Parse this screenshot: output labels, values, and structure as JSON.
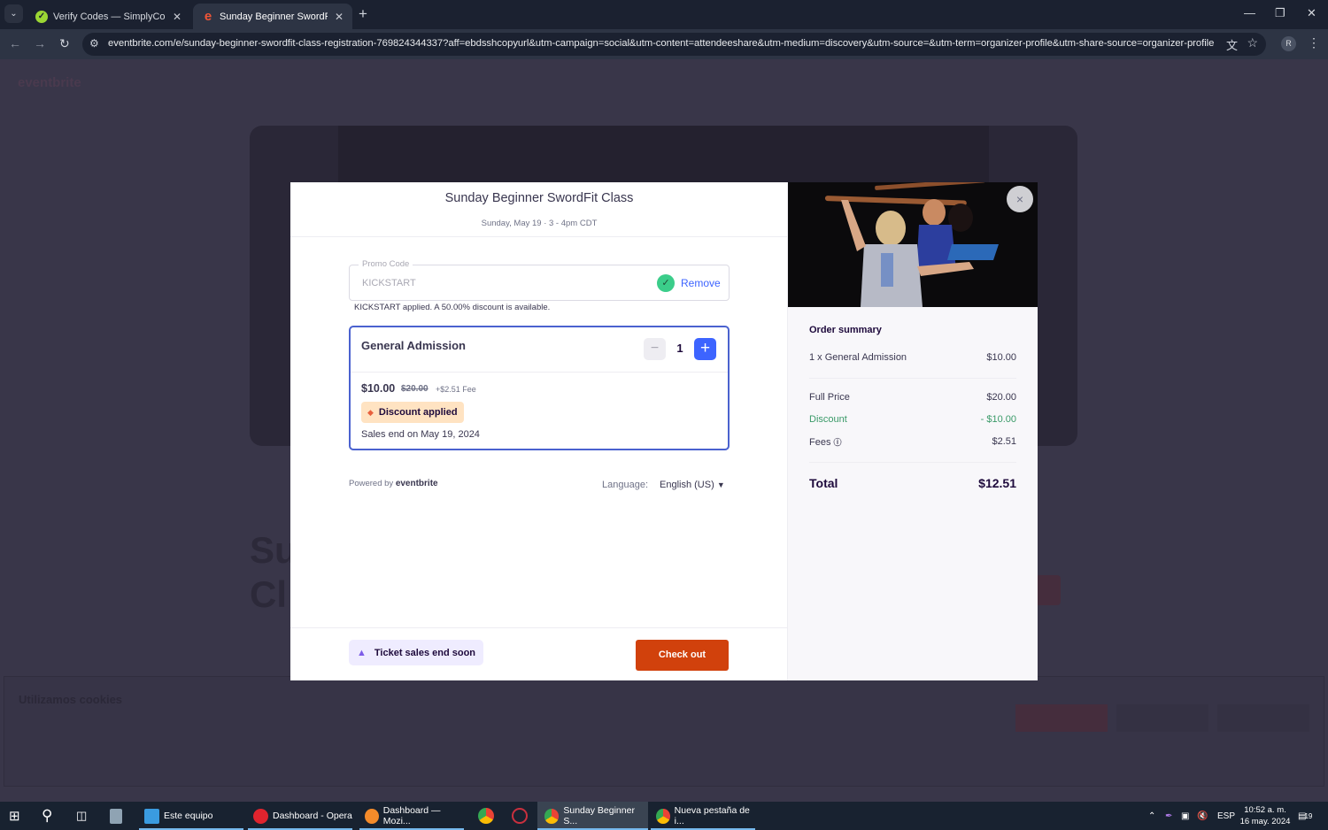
{
  "browser": {
    "tabs": [
      {
        "title": "Verify Codes — SimplyCodes",
        "icon": "simplycodes-icon",
        "active": false
      },
      {
        "title": "Sunday Beginner SwordFit Class",
        "icon": "eventbrite-icon",
        "active": true
      }
    ],
    "new_tab_label": "+",
    "url": "eventbrite.com/e/sunday-beginner-swordfit-class-registration-769824344337?aff=ebdsshcopyurl&utm-campaign=social&utm-content=attendeeshare&utm-medium=discovery&utm-source=&utm-term=organizer-profile&utm-share-source=organizer-profile",
    "profile_initial": "R"
  },
  "background_page": {
    "logo": "eventbrite",
    "cookie_title": "Utilizamos cookies",
    "title_fragment": "Su Cl"
  },
  "modal": {
    "event_title": "Sunday Beginner SwordFit Class",
    "event_date": "Sunday, May 19 · 3 - 4pm CDT",
    "promo": {
      "label": "Promo Code",
      "value": "KICKSTART",
      "remove_label": "Remove",
      "message": "KICKSTART applied. A 50.00% discount is available."
    },
    "ticket": {
      "name": "General Admission",
      "quantity": "1",
      "minus_label": "−",
      "plus_label": "+",
      "price": "$10.00",
      "original_price": "$20.00",
      "fee": "+$2.51 Fee",
      "discount_badge": "Discount applied",
      "sales_end": "Sales end on May 19, 2024"
    },
    "powered_by": "Powered by",
    "powered_brand": "eventbrite",
    "language_label": "Language:",
    "language_value": "English (US)",
    "urgency_label": "Ticket sales end soon",
    "checkout_label": "Check out",
    "close_label": "×",
    "summary": {
      "title": "Order summary",
      "line_item": {
        "label": "1 x General Admission",
        "value": "$10.00"
      },
      "full_price": {
        "label": "Full Price",
        "value": "$20.00"
      },
      "discount": {
        "label": "Discount",
        "value": "- $10.00"
      },
      "fees": {
        "label": "Fees",
        "value": "$2.51"
      },
      "total": {
        "label": "Total",
        "value": "$12.51"
      }
    }
  },
  "taskbar": {
    "items": [
      {
        "label": "Este equipo"
      },
      {
        "label": "Dashboard - Opera"
      },
      {
        "label": "Dashboard — Mozi..."
      },
      {
        "label": "Sunday Beginner S..."
      },
      {
        "label": "Nueva pestaña de i..."
      }
    ],
    "language": "ESP",
    "time": "10:52 a. m.",
    "date": "16 may. 2024",
    "notifications": "19"
  },
  "colors": {
    "accent_blue": "#3d64ff",
    "checkout_orange": "#d1410c",
    "discount_green": "#3a9a68",
    "badge_bg": "#ffe3c2",
    "urgency_bg": "#efecff"
  }
}
